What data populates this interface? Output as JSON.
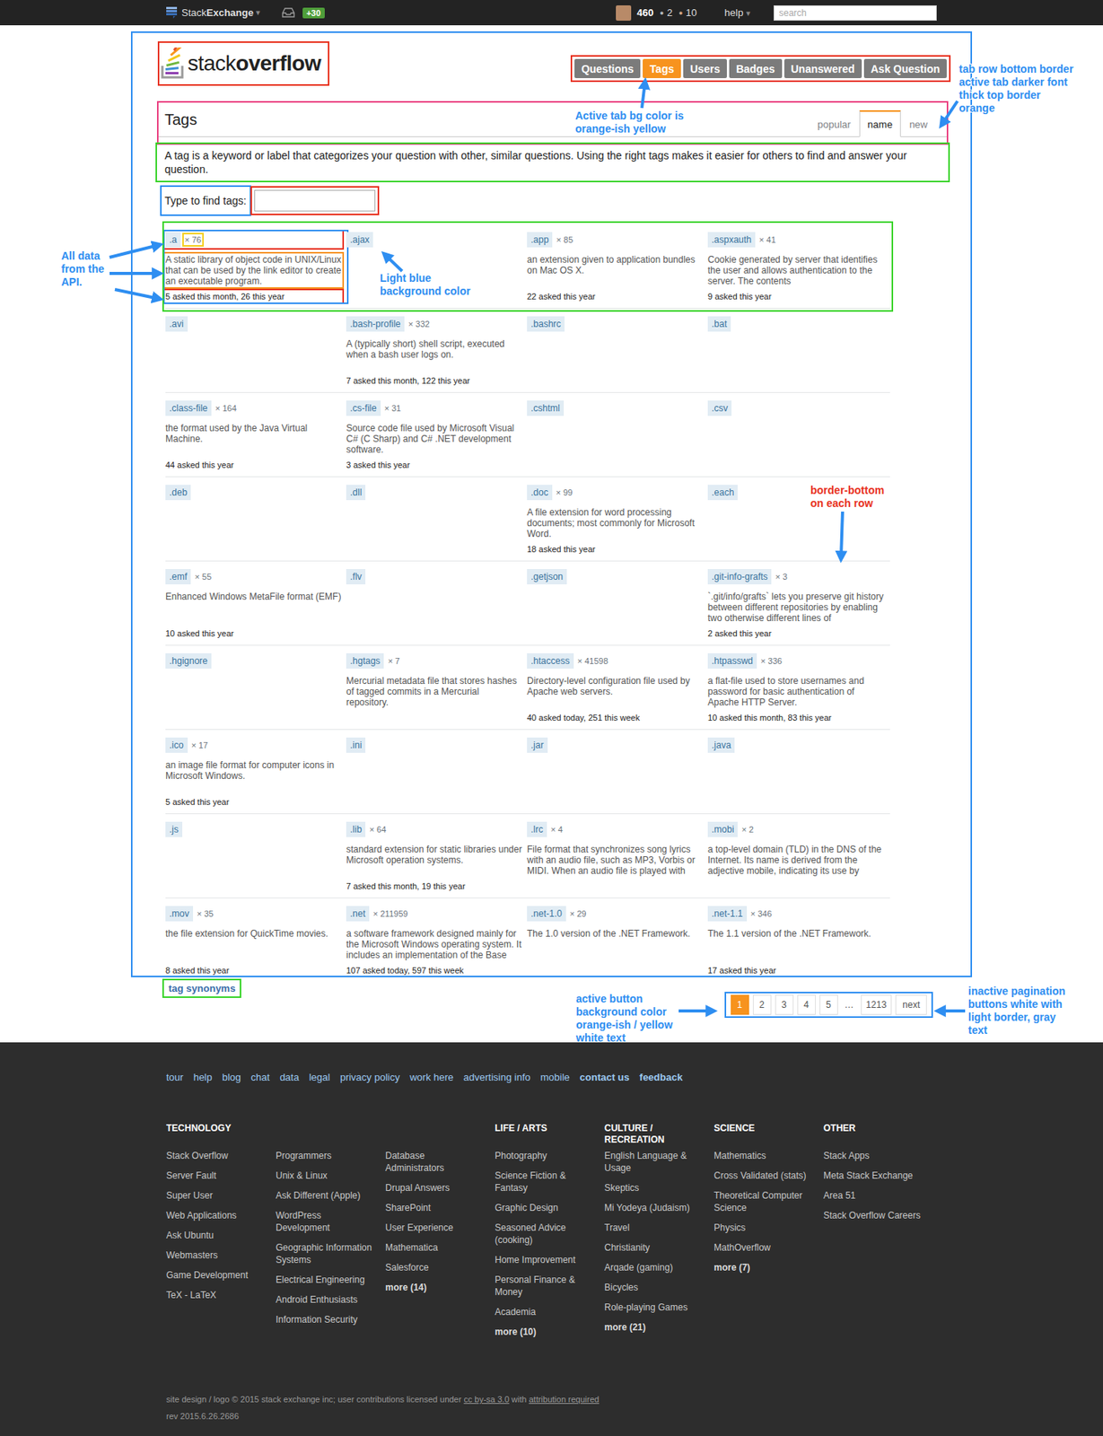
{
  "topbar": {
    "brand_light": "Stack",
    "brand_bold": "Exchange",
    "brand_caret": "▾",
    "achievement": "+30",
    "reputation": "460",
    "badges": [
      {
        "dot": "●",
        "count": "2",
        "color": "#b4b8bc"
      },
      {
        "dot": "●",
        "count": "10",
        "color": "#d1a684"
      }
    ],
    "help": "help",
    "help_caret": "▾",
    "search_placeholder": "search"
  },
  "logo": {
    "light": "stack",
    "bold": "overflow"
  },
  "nav": [
    {
      "label": "Questions",
      "selected": false
    },
    {
      "label": "Tags",
      "selected": true
    },
    {
      "label": "Users",
      "selected": false
    },
    {
      "label": "Badges",
      "selected": false
    },
    {
      "label": "Unanswered",
      "selected": false
    },
    {
      "label": "Ask Question",
      "selected": false
    }
  ],
  "page": {
    "title": "Tags",
    "sort_tabs": [
      {
        "label": "popular",
        "selected": false
      },
      {
        "label": "name",
        "selected": true
      },
      {
        "label": "new",
        "selected": false
      }
    ],
    "description": "A tag is a keyword or label that categorizes your question with other, similar questions. Using the right tags makes it easier for others to find and answer your question.",
    "filter_label": "Type to find tags:"
  },
  "tags": [
    {
      "name": ".a",
      "count": "× 76",
      "excerpt": "A static library of object code in UNIX/Linux that can be used by the link editor to create an executable program.",
      "stats": "5 asked this month, 26 this year"
    },
    {
      "name": ".ajax"
    },
    {
      "name": ".app",
      "count": "× 85",
      "excerpt": "an extension given to application bundles on Mac OS X.",
      "stats": "22 asked this year"
    },
    {
      "name": ".aspxauth",
      "count": "× 41",
      "excerpt": "Cookie generated by server that identifies the user and allows authentication to the server. The contents",
      "stats": "9 asked this year"
    },
    {
      "name": ".avi"
    },
    {
      "name": ".bash-profile",
      "count": "× 332",
      "excerpt": "A (typically short) shell script, executed when a bash user logs on.",
      "stats": "7 asked this month, 122 this year"
    },
    {
      "name": ".bashrc"
    },
    {
      "name": ".bat"
    },
    {
      "name": ".class-file",
      "count": "× 164",
      "excerpt": "the format used by the Java Virtual Machine.",
      "stats": "44 asked this year"
    },
    {
      "name": ".cs-file",
      "count": "× 31",
      "excerpt": "Source code file used by Microsoft Visual C# (C Sharp) and C# .NET development software.",
      "stats": "3 asked this year"
    },
    {
      "name": ".cshtml"
    },
    {
      "name": ".csv"
    },
    {
      "name": ".deb"
    },
    {
      "name": ".dll"
    },
    {
      "name": ".doc",
      "count": "× 99",
      "excerpt": "A file extension for word processing documents; most commonly for Microsoft Word.",
      "stats": "18 asked this year"
    },
    {
      "name": ".each"
    },
    {
      "name": ".emf",
      "count": "× 55",
      "excerpt": "Enhanced Windows MetaFile format (EMF)",
      "stats": "10 asked this year"
    },
    {
      "name": ".flv"
    },
    {
      "name": ".getjson"
    },
    {
      "name": ".git-info-grafts",
      "count": "× 3",
      "excerpt": "`.git/info/grafts` lets you preserve git history between different repositories by enabling two otherwise different lines of",
      "stats": "2 asked this year"
    },
    {
      "name": ".hgignore"
    },
    {
      "name": ".hgtags",
      "count": "× 7",
      "excerpt": "Mercurial metadata file that stores hashes of tagged commits in a Mercurial repository."
    },
    {
      "name": ".htaccess",
      "count": "× 41598",
      "excerpt": "Directory-level configuration file used by Apache web servers.",
      "stats": "40 asked today, 251 this week"
    },
    {
      "name": ".htpasswd",
      "count": "× 336",
      "excerpt": "a flat-file used to store usernames and password for basic authentication of Apache HTTP Server.",
      "stats": "10 asked this month, 83 this year"
    },
    {
      "name": ".ico",
      "count": "× 17",
      "excerpt": "an image file format for computer icons in Microsoft Windows.",
      "stats": "5 asked this year"
    },
    {
      "name": ".ini"
    },
    {
      "name": ".jar"
    },
    {
      "name": ".java"
    },
    {
      "name": ".js"
    },
    {
      "name": ".lib",
      "count": "× 64",
      "excerpt": "standard extension for static libraries under Microsoft operation systems.",
      "stats": "7 asked this month, 19 this year"
    },
    {
      "name": ".lrc",
      "count": "× 4",
      "excerpt": "File format that synchronizes song lyrics with an audio file, such as MP3, Vorbis or MIDI. When an audio file is played with"
    },
    {
      "name": ".mobi",
      "count": "× 2",
      "excerpt": "a top-level domain (TLD) in the DNS of the Internet. Its name is derived from the adjective mobile, indicating its use by"
    },
    {
      "name": ".mov",
      "count": "× 35",
      "excerpt": "the file extension for QuickTime movies.",
      "stats": "8 asked this year"
    },
    {
      "name": ".net",
      "count": "× 211959",
      "excerpt": "a software framework designed mainly for the Microsoft Windows operating system. It includes an implementation of the Base",
      "stats": "107 asked today, 597 this week"
    },
    {
      "name": ".net-1.0",
      "count": "× 29",
      "excerpt": "The 1.0 version of the .NET Framework."
    },
    {
      "name": ".net-1.1",
      "count": "× 346",
      "excerpt": "The 1.1 version of the .NET Framework.",
      "stats": "17 asked this year"
    }
  ],
  "tag_synonyms": "tag synonyms",
  "pagination": [
    {
      "label": "1",
      "kind": "page",
      "selected": true
    },
    {
      "label": "2",
      "kind": "page",
      "selected": false
    },
    {
      "label": "3",
      "kind": "page",
      "selected": false
    },
    {
      "label": "4",
      "kind": "page",
      "selected": false
    },
    {
      "label": "5",
      "kind": "page",
      "selected": false
    },
    {
      "label": "…",
      "kind": "gap",
      "selected": false
    },
    {
      "label": "1213",
      "kind": "page",
      "selected": false
    },
    {
      "label": "next",
      "kind": "next",
      "selected": false
    }
  ],
  "footer": {
    "links": [
      {
        "label": "tour",
        "emphasized": false
      },
      {
        "label": "help",
        "emphasized": false
      },
      {
        "label": "blog",
        "emphasized": false
      },
      {
        "label": "chat",
        "emphasized": false
      },
      {
        "label": "data",
        "emphasized": false
      },
      {
        "label": "legal",
        "emphasized": false
      },
      {
        "label": "privacy policy",
        "emphasized": false
      },
      {
        "label": "work here",
        "emphasized": false
      },
      {
        "label": "advertising info",
        "emphasized": false
      },
      {
        "label": "mobile",
        "emphasized": false
      },
      {
        "label": "contact us",
        "emphasized": true
      },
      {
        "label": "feedback",
        "emphasized": true
      }
    ],
    "sections": [
      {
        "title": "TECHNOLOGY",
        "columns": [
          [
            {
              "label": "Stack Overflow",
              "emphasized": false
            },
            {
              "label": "Server Fault",
              "emphasized": false
            },
            {
              "label": "Super User",
              "emphasized": false
            },
            {
              "label": "Web Applications",
              "emphasized": false
            },
            {
              "label": "Ask Ubuntu",
              "emphasized": false
            },
            {
              "label": "Webmasters",
              "emphasized": false
            },
            {
              "label": "Game Development",
              "emphasized": false
            },
            {
              "label": "TeX - LaTeX",
              "emphasized": false
            }
          ],
          [
            {
              "label": "Programmers",
              "emphasized": false
            },
            {
              "label": "Unix & Linux",
              "emphasized": false
            },
            {
              "label": "Ask Different (Apple)",
              "emphasized": false
            },
            {
              "label": "WordPress Development",
              "emphasized": false
            },
            {
              "label": "Geographic Information Systems",
              "emphasized": false
            },
            {
              "label": "Electrical Engineering",
              "emphasized": false
            },
            {
              "label": "Android Enthusiasts",
              "emphasized": false
            },
            {
              "label": "Information Security",
              "emphasized": false
            }
          ],
          [
            {
              "label": "Database Administrators",
              "emphasized": false
            },
            {
              "label": "Drupal Answers",
              "emphasized": false
            },
            {
              "label": "SharePoint",
              "emphasized": false
            },
            {
              "label": "User Experience",
              "emphasized": false
            },
            {
              "label": "Mathematica",
              "emphasized": false
            },
            {
              "label": "Salesforce",
              "emphasized": false
            },
            {
              "label": "more (14)",
              "emphasized": true
            }
          ]
        ]
      },
      {
        "title": "LIFE / ARTS",
        "columns": [
          [
            {
              "label": "Photography",
              "emphasized": false
            },
            {
              "label": "Science Fiction & Fantasy",
              "emphasized": false
            },
            {
              "label": "Graphic Design",
              "emphasized": false
            },
            {
              "label": "Seasoned Advice (cooking)",
              "emphasized": false
            },
            {
              "label": "Home Improvement",
              "emphasized": false
            },
            {
              "label": "Personal Finance & Money",
              "emphasized": false
            },
            {
              "label": "Academia",
              "emphasized": false
            },
            {
              "label": "more (10)",
              "emphasized": true
            }
          ]
        ]
      },
      {
        "title": "CULTURE / RECREATION",
        "columns": [
          [
            {
              "label": "English Language & Usage",
              "emphasized": false
            },
            {
              "label": "Skeptics",
              "emphasized": false
            },
            {
              "label": "Mi Yodeya (Judaism)",
              "emphasized": false
            },
            {
              "label": "Travel",
              "emphasized": false
            },
            {
              "label": "Christianity",
              "emphasized": false
            },
            {
              "label": "Arqade (gaming)",
              "emphasized": false
            },
            {
              "label": "Bicycles",
              "emphasized": false
            },
            {
              "label": "Role-playing Games",
              "emphasized": false
            },
            {
              "label": "more (21)",
              "emphasized": true
            }
          ]
        ]
      },
      {
        "title": "SCIENCE",
        "columns": [
          [
            {
              "label": "Mathematics",
              "emphasized": false
            },
            {
              "label": "Cross Validated (stats)",
              "emphasized": false
            },
            {
              "label": "Theoretical Computer Science",
              "emphasized": false
            },
            {
              "label": "Physics",
              "emphasized": false
            },
            {
              "label": "MathOverflow",
              "emphasized": false
            },
            {
              "label": "more (7)",
              "emphasized": true
            }
          ]
        ]
      },
      {
        "title": "OTHER",
        "columns": [
          [
            {
              "label": "Stack Apps",
              "emphasized": false
            },
            {
              "label": "Meta Stack Exchange",
              "emphasized": false
            },
            {
              "label": "Area 51",
              "emphasized": false
            },
            {
              "label": "Stack Overflow Careers",
              "emphasized": false
            }
          ]
        ]
      }
    ],
    "legal_text": "site design / logo © 2015 stack exchange inc; user contributions licensed under ",
    "license_link": "cc by-sa 3.0",
    "legal_mid": " with ",
    "attribution_link": "attribution required",
    "revision": "rev 2015.6.26.2686"
  },
  "annotations": [
    {
      "text": "Active tab bg color is\norange-ish yellow",
      "color": "#2e8ef1"
    },
    {
      "text": "tab row bottom border\nactive tab darker font\nthick top border\norange",
      "color": "#2e8ef1"
    },
    {
      "text": "All data\nfrom the\nAPI.",
      "color": "#2e8ef1"
    },
    {
      "text": "Light blue\nbackground color",
      "color": "#2e8ef1"
    },
    {
      "text": "border-bottom\non each row",
      "color": "#e8321e"
    },
    {
      "text": "active button\nbackground color\norange-ish / yellow\nwhite text",
      "color": "#2e8ef1"
    },
    {
      "text": "inactive pagination\nbuttons white with\nlight border, gray\ntext",
      "color": "#2e8ef1"
    }
  ]
}
